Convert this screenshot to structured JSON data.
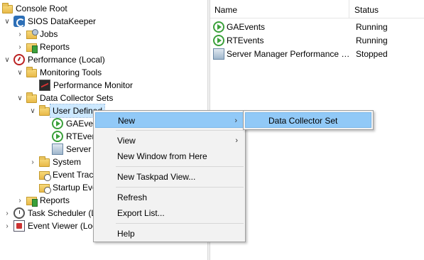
{
  "tree": {
    "console_root": "Console Root",
    "sios": "SIOS DataKeeper",
    "jobs": "Jobs",
    "reports_sios": "Reports",
    "performance": "Performance (Local)",
    "monitoring_tools": "Monitoring Tools",
    "performance_monitor": "Performance Monitor",
    "data_collector_sets": "Data Collector Sets",
    "user_defined": "User Defined",
    "gaevents": "GAEvents",
    "rtevents": "RTEvents",
    "server": "Server Manager Performance Monitor",
    "system": "System",
    "event_trace": "Event Trace Sessions",
    "startup_event": "Startup Event Trace Sessions",
    "reports_perf": "Reports",
    "task_scheduler": "Task Scheduler (Local)",
    "event_viewer": "Event Viewer (Local)"
  },
  "list": {
    "col_name": "Name",
    "col_status": "Status",
    "rows": [
      {
        "name": "GAEvents",
        "status": "Running",
        "icon": "collector-running-icon"
      },
      {
        "name": "RTEvents",
        "status": "Running",
        "icon": "collector-running-icon"
      },
      {
        "name": "Server Manager Performance Monitor",
        "status": "Stopped",
        "icon": "collector-stopped-icon"
      }
    ]
  },
  "menu": {
    "new": "New",
    "view": "View",
    "new_window": "New Window from Here",
    "new_taskpad": "New Taskpad View...",
    "refresh": "Refresh",
    "export_list": "Export List...",
    "help": "Help",
    "submenu_arrow": "›"
  },
  "submenu": {
    "data_collector_set": "Data Collector Set"
  },
  "colors": {
    "menu_highlight": "#91c9f7",
    "selection": "#cce8ff"
  }
}
